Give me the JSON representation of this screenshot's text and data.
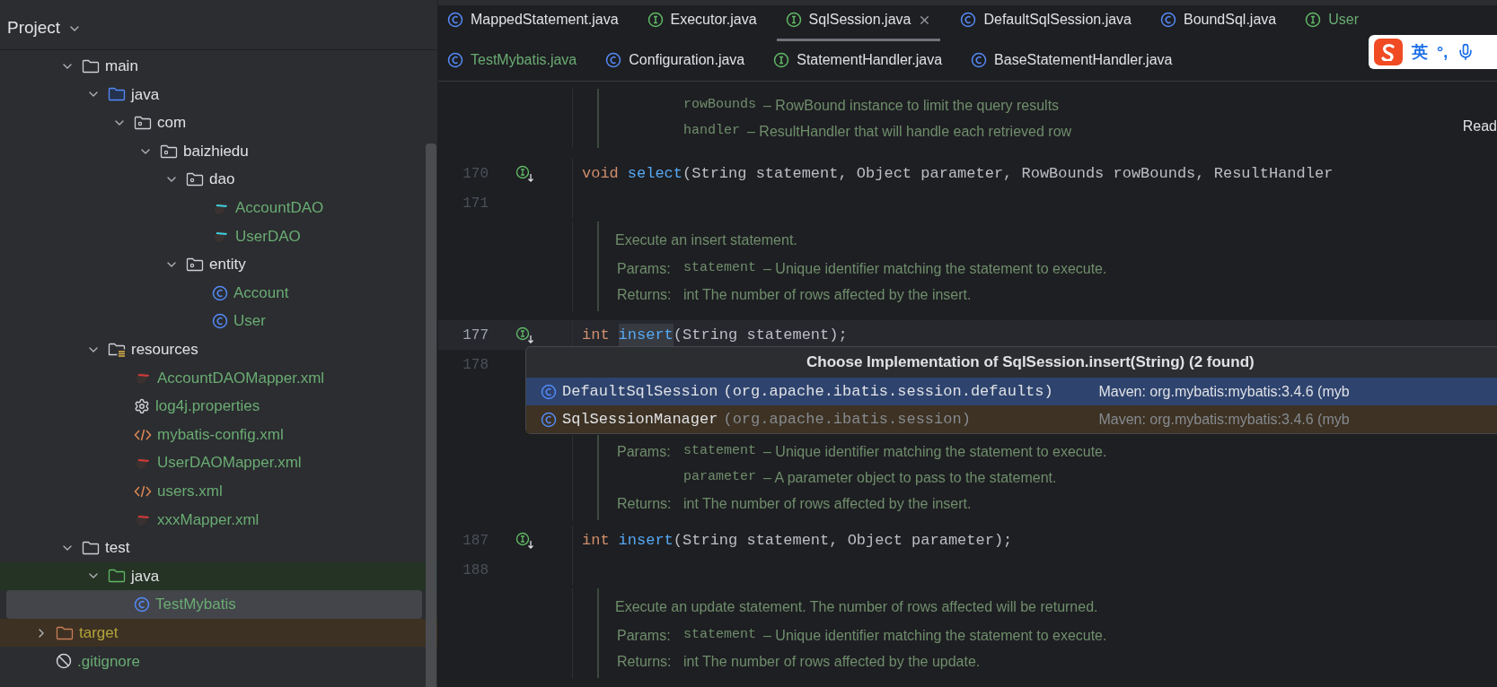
{
  "project_panel": {
    "title": "Project",
    "tree": {
      "nested_items": [
        {
          "label": "main",
          "kind": "folder",
          "added": false,
          "expanded": true,
          "selected": false,
          "children": [
            {
              "label": "java",
              "kind": "source",
              "added": false,
              "expanded": true,
              "selected": false,
              "children": [
                {
                  "label": "com",
                  "kind": "package",
                  "added": false,
                  "expanded": true,
                  "selected": false,
                  "children": [
                    {
                      "label": "baizhiedu",
                      "kind": "package",
                      "added": false,
                      "expanded": true,
                      "selected": false,
                      "children": [
                        {
                          "label": "dao",
                          "kind": "package",
                          "added": false,
                          "expanded": true,
                          "selected": false,
                          "children": [
                            {
                              "label": "AccountDAO",
                              "kind": "mybatis",
                              "added": true,
                              "selected": false
                            },
                            {
                              "label": "UserDAO",
                              "kind": "mybatis",
                              "added": true,
                              "selected": false
                            }
                          ]
                        },
                        {
                          "label": "entity",
                          "kind": "package",
                          "added": false,
                          "expanded": true,
                          "selected": false,
                          "children": [
                            {
                              "label": "Account",
                              "kind": "class",
                              "added": true,
                              "selected": false
                            },
                            {
                              "label": "User",
                              "kind": "class",
                              "added": true,
                              "selected": false
                            }
                          ]
                        }
                      ]
                    }
                  ]
                }
              ]
            },
            {
              "label": "resources",
              "kind": "resources",
              "added": false,
              "expanded": true,
              "selected": false,
              "children": [
                {
                  "label": "AccountDAOMapper.xml",
                  "kind": "mapper",
                  "added": true,
                  "selected": false
                },
                {
                  "label": "log4j.properties",
                  "kind": "properties",
                  "added": true,
                  "selected": false
                },
                {
                  "label": "mybatis-config.xml",
                  "kind": "xml",
                  "added": true,
                  "selected": false
                },
                {
                  "label": "UserDAOMapper.xml",
                  "kind": "mapper",
                  "added": true,
                  "selected": false
                },
                {
                  "label": "users.xml",
                  "kind": "xml",
                  "added": true,
                  "selected": false
                },
                {
                  "label": "xxxMapper.xml",
                  "kind": "mapper",
                  "added": true,
                  "selected": false
                }
              ]
            }
          ]
        },
        {
          "label": "test",
          "kind": "folder",
          "added": false,
          "expanded": true,
          "selected": false,
          "children": [
            {
              "label": "java",
              "kind": "test-source",
              "added": false,
              "expanded": true,
              "selected": false,
              "children": [
                {
                  "label": "TestMybatis",
                  "kind": "class",
                  "added": true,
                  "selected": true
                }
              ]
            }
          ]
        }
      ],
      "items": [
        {
          "label": "target",
          "kind": "excluded-folder",
          "expanded": false,
          "selected": false
        },
        {
          "label": ".gitignore",
          "kind": "ignore",
          "added": true,
          "selected": false
        }
      ]
    }
  },
  "tab_rows": [
    [
      {
        "label": "MappedStatement.java",
        "kind": "class",
        "added": false,
        "selected": false
      },
      {
        "label": "Executor.java",
        "kind": "interface",
        "added": false,
        "selected": false
      },
      {
        "label": "SqlSession.java",
        "kind": "interface",
        "added": false,
        "selected": true
      },
      {
        "label": "DefaultSqlSession.java",
        "kind": "class",
        "added": false,
        "selected": false
      },
      {
        "label": "BoundSql.java",
        "kind": "class",
        "added": false,
        "selected": false
      },
      {
        "label": "User",
        "kind": "interface",
        "added": true,
        "selected": false
      }
    ],
    [
      {
        "label": "TestMybatis.java",
        "kind": "class",
        "added": true,
        "selected": false
      },
      {
        "label": "Configuration.java",
        "kind": "class",
        "added": false,
        "selected": false
      },
      {
        "label": "StatementHandler.java",
        "kind": "interface",
        "added": false,
        "selected": false
      },
      {
        "label": "BaseStatementHandler.java",
        "kind": "class",
        "added": false,
        "selected": false
      }
    ]
  ],
  "ime_bar": {
    "mode": "英",
    "punctuation": "°,"
  },
  "editor": {
    "reader_mode": "Read",
    "rows": [
      {
        "kind": "doc",
        "lines": [
          {
            "code": "rowBounds",
            "text": "– RowBound instance to limit the query results"
          },
          {
            "code": "handler",
            "text": "– ResultHandler that will handle each retrieved row"
          }
        ]
      },
      {
        "kind": "code",
        "number": "170",
        "current": false,
        "implemented": true,
        "tokens": [
          {
            "kind": "keyword",
            "text": "void"
          },
          {
            "kind": "method",
            "text": "select"
          },
          {
            "kind": "plain",
            "text": "(String statement, Object parameter, RowBounds rowBounds, ResultHandler"
          }
        ]
      },
      {
        "kind": "code",
        "number": "171",
        "current": false,
        "implemented": false,
        "tokens": []
      },
      {
        "kind": "doc",
        "lines": [
          {
            "summary": "Execute an insert statement."
          },
          {
            "label": "Params:",
            "code": "statement",
            "text": "– Unique identifier matching the statement to execute."
          },
          {
            "label": "Returns:",
            "text": "int The number of rows affected by the insert."
          }
        ]
      },
      {
        "kind": "code",
        "number": "177",
        "current": true,
        "implemented": true,
        "tokens": [
          {
            "kind": "keyword",
            "text": "int"
          },
          {
            "kind": "method",
            "text": "insert",
            "highlight": true
          },
          {
            "kind": "plain",
            "text": "(String statement);"
          }
        ]
      },
      {
        "kind": "code",
        "number": "178",
        "current": false,
        "implemented": false,
        "tokens": []
      },
      {
        "kind": "doc",
        "lines": [
          {
            "label": "Params:",
            "code": "statement",
            "text": "– Unique identifier matching the statement to execute."
          },
          {
            "code": "parameter",
            "text": "– A parameter object to pass to the statement."
          },
          {
            "label": "Returns:",
            "text": "int The number of rows affected by the insert."
          }
        ]
      },
      {
        "kind": "code",
        "number": "187",
        "current": false,
        "implemented": true,
        "tokens": [
          {
            "kind": "keyword",
            "text": "int"
          },
          {
            "kind": "method",
            "text": "insert",
            "highlight": false
          },
          {
            "kind": "plain",
            "text": "(String statement, Object parameter);"
          }
        ]
      },
      {
        "kind": "code",
        "number": "188",
        "current": false,
        "implemented": false,
        "tokens": []
      },
      {
        "kind": "doc",
        "lines": [
          {
            "summary": "Execute an update statement. The number of rows affected will be returned."
          },
          {
            "label": "Params:",
            "code": "statement",
            "text": "– Unique identifier matching the statement to execute."
          },
          {
            "label": "Returns:",
            "text": "int The number of rows affected by the update."
          }
        ]
      }
    ]
  },
  "implementation_popup": {
    "title": "Choose Implementation of SqlSession.insert(String) (2 found)",
    "items": [
      {
        "name": "DefaultSqlSession",
        "package": "(org.apache.ibatis.session.defaults)",
        "source": "Maven: org.mybatis:mybatis:3.4.6 (myb",
        "selected": true
      },
      {
        "name": "SqlSessionManager",
        "package": "(org.apache.ibatis.session)",
        "source": "Maven: org.mybatis:mybatis:3.4.6 (myb",
        "selected": false
      }
    ]
  }
}
